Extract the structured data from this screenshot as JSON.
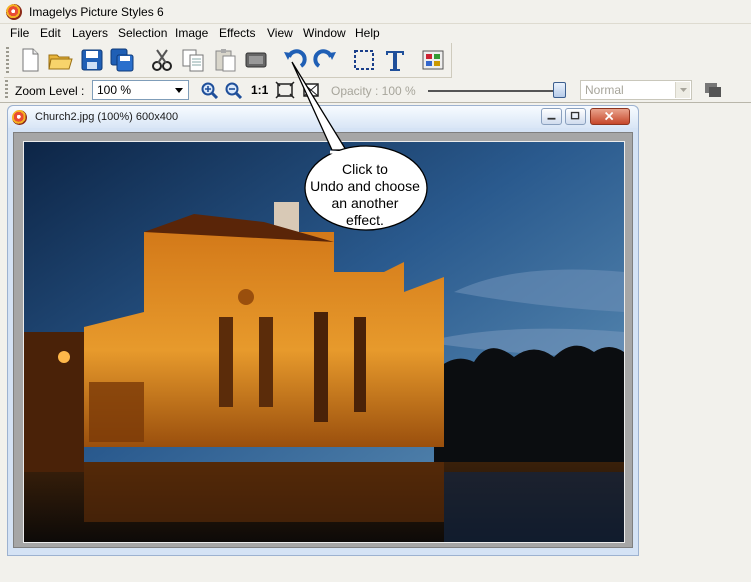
{
  "app": {
    "title": "Imagelys Picture Styles 6"
  },
  "menu": [
    "File",
    "Edit",
    "Layers",
    "Selection",
    "Image",
    "Effects",
    "View",
    "Window",
    "Help"
  ],
  "toolbar": {
    "buttons": [
      "new-document-icon",
      "open-folder-icon",
      "save-icon",
      "save-all-icon",
      "cut-icon",
      "copy-icon",
      "paste-icon",
      "scan-icon",
      "undo-icon",
      "redo-icon",
      "selection-rectangle-icon",
      "text-tool-icon",
      "effects-gallery-icon"
    ]
  },
  "zoombar": {
    "zoom_label": "Zoom Level :",
    "zoom_value": "100 %",
    "one_to_one": "1:1",
    "opacity_label": "Opacity : 100 %",
    "opacity_value": 1.0,
    "blend_mode": "Normal"
  },
  "document": {
    "title": "Church2.jpg (100%) 600x400"
  },
  "callout": {
    "lines": [
      "Click to",
      "Undo and choose",
      "an another",
      "effect."
    ]
  },
  "colors": {
    "accent": "#1f5fb5",
    "toolbar_bg": "#f2f1ec",
    "doc_frame": "#d5e3f5"
  }
}
